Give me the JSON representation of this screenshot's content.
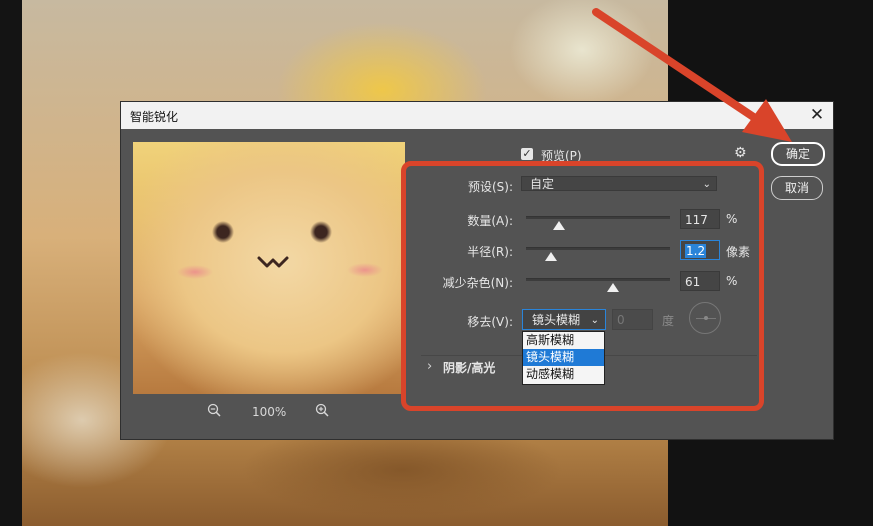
{
  "dialog": {
    "title": "智能锐化",
    "close_symbol": "✕"
  },
  "preview": {
    "zoom_level": "100%",
    "zoom_out_icon": "zoom-out-icon",
    "zoom_in_icon": "zoom-in-icon"
  },
  "options": {
    "preview_checkbox_label": "预览(P)",
    "preview_checked": true,
    "gear_icon": "gear-icon"
  },
  "buttons": {
    "ok": "确定",
    "cancel": "取消"
  },
  "form": {
    "preset_label": "预设(S):",
    "preset_value": "自定",
    "amount_label": "数量(A):",
    "amount_value": "117",
    "amount_unit": "%",
    "radius_label": "半径(R):",
    "radius_value": "1.2",
    "radius_unit": "像素",
    "noise_label": "减少杂色(N):",
    "noise_value": "61",
    "noise_unit": "%",
    "remove_label": "移去(V):",
    "remove_value": "镜头模糊",
    "angle_value": "0",
    "angle_unit": "度"
  },
  "remove_options": [
    "高斯模糊",
    "镜头模糊",
    "动感模糊"
  ],
  "remove_selected_index": 1,
  "section": {
    "shadows_highlights": "阴影/高光"
  },
  "annotation_color": "#d9442a"
}
